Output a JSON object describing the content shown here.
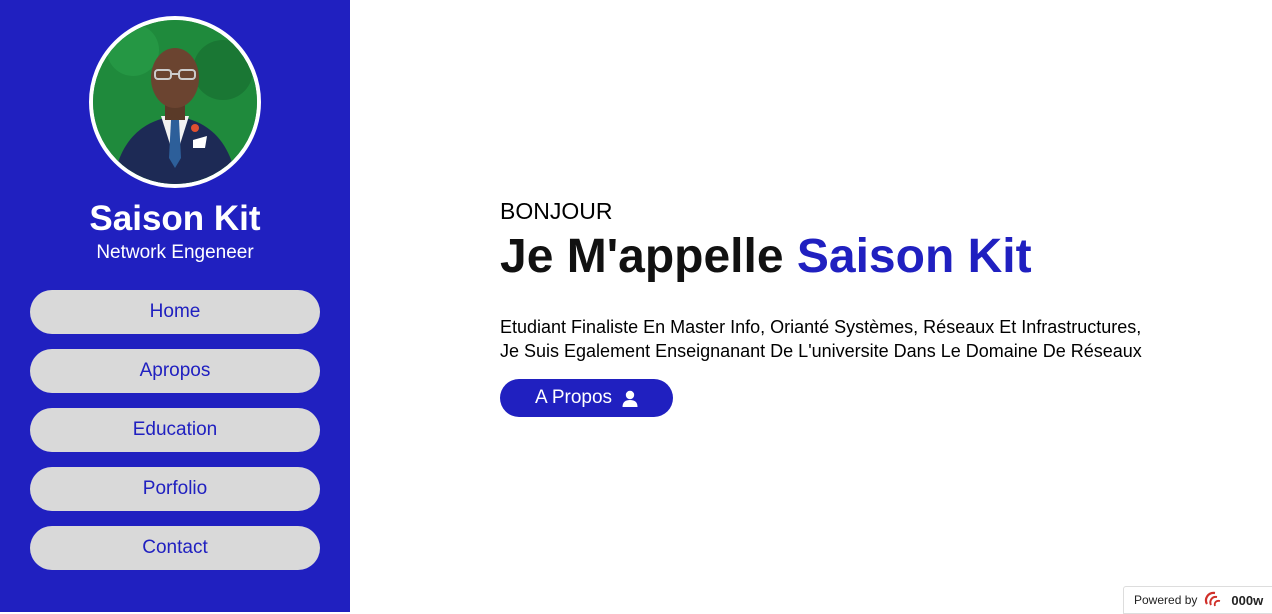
{
  "sidebar": {
    "name": "Saison Kit",
    "role": "Network Engeneer",
    "nav": [
      {
        "label": "Home"
      },
      {
        "label": "Apropos"
      },
      {
        "label": "Education"
      },
      {
        "label": "Porfolio"
      },
      {
        "label": "Contact"
      }
    ]
  },
  "hero": {
    "greeting": "BONJOUR",
    "headline_prefix": "Je M'appelle",
    "headline_name": "Saison Kit",
    "description": "Etudiant Finaliste En Master Info, Orianté Systèmes, Réseaux Et Infrastructures, Je Suis Egalement Enseignanant De L'universite Dans Le Domaine De Réseaux",
    "button_label": "A Propos",
    "button_icon": "user-icon"
  },
  "footer_badge": {
    "text": "Powered by",
    "brand": "000w"
  },
  "colors": {
    "primary": "#2020c0",
    "nav_background": "#d9d9d9",
    "text": "#000000"
  }
}
